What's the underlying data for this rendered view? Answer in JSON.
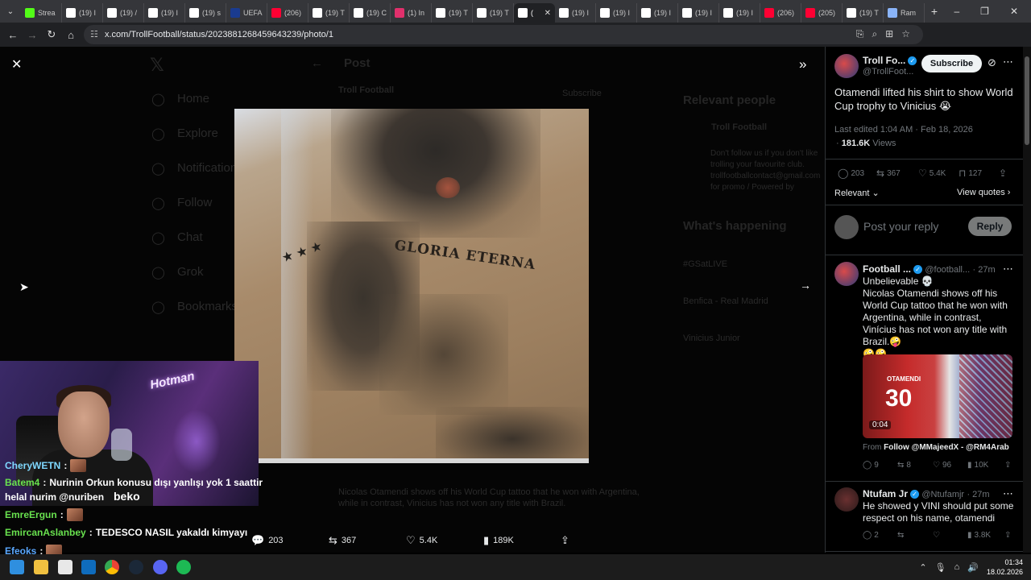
{
  "browser": {
    "tabs": [
      {
        "label": "Strea",
        "icon": "kick-icon",
        "color": "#53fc18"
      },
      {
        "label": "(19) I",
        "icon": "x-icon",
        "color": "#ffffff"
      },
      {
        "label": "(19) /",
        "icon": "x-icon",
        "color": "#ffffff"
      },
      {
        "label": "(19) I",
        "icon": "x-icon",
        "color": "#ffffff"
      },
      {
        "label": "(19) s",
        "icon": "x-icon",
        "color": "#ffffff"
      },
      {
        "label": "UEFA",
        "icon": "uefa-icon",
        "color": "#1a3b8f"
      },
      {
        "label": "(206)",
        "icon": "youtube-icon",
        "color": "#ff0033"
      },
      {
        "label": "(19) T",
        "icon": "x-icon",
        "color": "#ffffff"
      },
      {
        "label": "(19) C",
        "icon": "x-icon",
        "color": "#ffffff"
      },
      {
        "label": "(1) In",
        "icon": "instagram-icon",
        "color": "#e1306c"
      },
      {
        "label": "(19) T",
        "icon": "x-icon",
        "color": "#ffffff"
      },
      {
        "label": "(19) T",
        "icon": "x-icon",
        "color": "#ffffff"
      },
      {
        "label": "(",
        "icon": "x-icon",
        "color": "#ffffff",
        "active": true
      },
      {
        "label": "(19) I",
        "icon": "x-icon",
        "color": "#ffffff"
      },
      {
        "label": "(19) I",
        "icon": "x-icon",
        "color": "#ffffff"
      },
      {
        "label": "(19) I",
        "icon": "x-icon",
        "color": "#ffffff"
      },
      {
        "label": "(19) I",
        "icon": "x-icon",
        "color": "#ffffff"
      },
      {
        "label": "(19) I",
        "icon": "x-icon",
        "color": "#ffffff"
      },
      {
        "label": "(206)",
        "icon": "youtube-icon",
        "color": "#ff0033"
      },
      {
        "label": "(205)",
        "icon": "youtube-icon",
        "color": "#ff0033"
      },
      {
        "label": "(19) T",
        "icon": "x-icon",
        "color": "#ffffff"
      },
      {
        "label": "Ram",
        "icon": "doc-icon",
        "color": "#8ab4f8"
      }
    ],
    "url": "x.com/TrollFootball/status/2023881268459643239/photo/1"
  },
  "background": {
    "nav": [
      "Home",
      "Explore",
      "Notifications",
      "Follow",
      "Chat",
      "Grok",
      "Bookmarks"
    ],
    "header": "Post",
    "subscribe": "Subscribe",
    "relevant_people": "Relevant people",
    "whats_happening": "What's happening",
    "trends": [
      "#GSatLIVE",
      "Benfica - Real Madrid",
      "Vinicius Junior"
    ],
    "bio": "Don't follow us if you don't like trolling your favourite club. trollfootballcontact@gmail.com for promo / Powered by",
    "ghost_tweet": "Nicolas Otamendi shows off his World Cup tattoo that he won with Argentina, while in contrast, Vinicius has not won any title with Brazil."
  },
  "photo": {
    "tattoo_text": "GLORIA ETERNA",
    "progress": 1.0
  },
  "media_actions": {
    "replies": "203",
    "reposts": "367",
    "likes": "5.4K",
    "views": "189K"
  },
  "chat": [
    {
      "user": "CheryWETN",
      "text": "",
      "color": "#7fd8ff",
      "emote": true
    },
    {
      "user": "Batem4",
      "text": "Nurinin Orkun konusu dışı yanlışı yok 1 saattir",
      "color": "#69e24f",
      "emote": false
    },
    {
      "user": "",
      "text": "helal nurim @nuriben",
      "color": "#ffffff",
      "emote": false
    },
    {
      "user": "EmreErgun",
      "text": "",
      "color": "#69e24f",
      "emote": true
    },
    {
      "user": "EmircanAslanbey",
      "text": "TEDESCO NASIL yakaldı kimyayı",
      "color": "#69e24f",
      "emote": false
    },
    {
      "user": "Efeoks",
      "text": "",
      "color": "#5aa8ff",
      "emote": true
    }
  ],
  "webcam": {
    "neon_sign": "Hotman",
    "shirt_text": "beko"
  },
  "post": {
    "author_name": "Troll Fo...",
    "author_handle": "@TrollFoot...",
    "subscribe": "Subscribe",
    "text": "Otamendi lifted his shirt to show World Cup trophy to Vinicius 😭",
    "edited": "Last edited 1:04 AM · Feb 18, 2026",
    "views_count": "181.6K",
    "views_label": "Views",
    "replies": "203",
    "reposts": "367",
    "likes": "5.4K",
    "bookmarks": "127",
    "sort_label": "Relevant",
    "view_quotes": "View quotes",
    "reply_placeholder": "Post your reply",
    "reply_button": "Reply"
  },
  "replies": [
    {
      "name": "Football ...",
      "handle": "@football...",
      "time": "· 27m",
      "text": "Unbelievable 💀\nNicolas Otamendi shows off his World Cup tattoo that he won with Argentina, while in contrast, Vinícius has not won any title with Brazil.🤪\n🤪🤪",
      "video_time": "0:04",
      "player_name": "OTAMENDI",
      "player_number": "30",
      "from_label": "From",
      "from_accounts": "Follow @MMajeedX - @RM4Arab",
      "stats": {
        "replies": "9",
        "reposts": "8",
        "likes": "96",
        "views": "10K"
      }
    },
    {
      "name": "Ntufam Jr",
      "handle": "@Ntufamjr",
      "time": "· 27m",
      "text": "He showed y VINI should put some respect on his name, otamendi",
      "stats": {
        "replies": "2",
        "reposts": "",
        "likes": "",
        "views": "3.8K"
      }
    }
  ],
  "taskbar": {
    "time": "01:34",
    "date": "18.02.2026"
  }
}
